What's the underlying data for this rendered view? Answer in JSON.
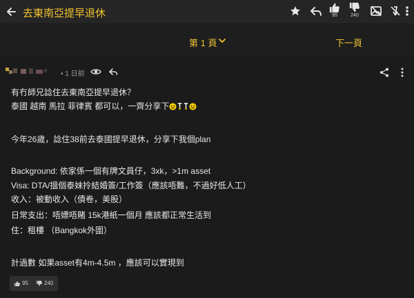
{
  "topbar": {
    "title": "去東南亞提早退休",
    "like_count": "95",
    "dislike_count": "240"
  },
  "pagination": {
    "current_label": "第 1 頁",
    "next_label": "下一頁"
  },
  "post": {
    "time": "• 1 日前",
    "lines": [
      "有冇師兄諗住去東南亞提早退休？",
      "泰國 越南 馬拉 菲律賓 都可以，一齊分享下",
      "今年26歲，諗住38前去泰國提早退休，分享下我個plan",
      "Background: 依家係一個有牌文員仔，3xk，>1m asset",
      "Visa: DTA/搵個泰妹拎結婚簽/工作簽（應該唔難，不過好低人工）",
      "收入：被動收入（債卷，美股）",
      "日常支出：唔嫖唔賭 15k港紙一個月 應該都正常生活到",
      "住：租樓 （Bangkok外圍）",
      "計過數 如果asset有4m-4.5m ，應該可以實現到"
    ],
    "likes": "95",
    "dislikes": "240"
  },
  "colors": {
    "accent": "#f2c231",
    "background": "#1b1b1b",
    "header": "#252525"
  },
  "icons": [
    "back-arrow-icon",
    "star-icon",
    "reply-icon",
    "thumbs-up-icon",
    "thumbs-down-icon",
    "image-icon",
    "no-signal-icon",
    "more-vertical-icon",
    "chevron-down-icon",
    "eye-icon",
    "share-icon"
  ]
}
